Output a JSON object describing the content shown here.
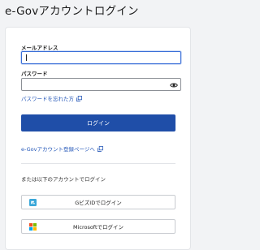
{
  "page": {
    "title": "e-Govアカウントログイン"
  },
  "form": {
    "email_label": "メールアドレス",
    "email_value": "",
    "password_label": "パスワード",
    "password_value": "",
    "forgot_password_link": "パスワードを忘れた方",
    "login_button": "ログイン",
    "register_link": "e-Govアカウント登録ページへ"
  },
  "alternatives": {
    "heading": "または以下のアカウントでログイン",
    "gbiz_button": "GビズIDでログイン",
    "microsoft_button": "Microsoftでログイン"
  },
  "colors": {
    "primary": "#1f4ea8",
    "link": "#2457b8",
    "focus": "#3a6fd8"
  }
}
